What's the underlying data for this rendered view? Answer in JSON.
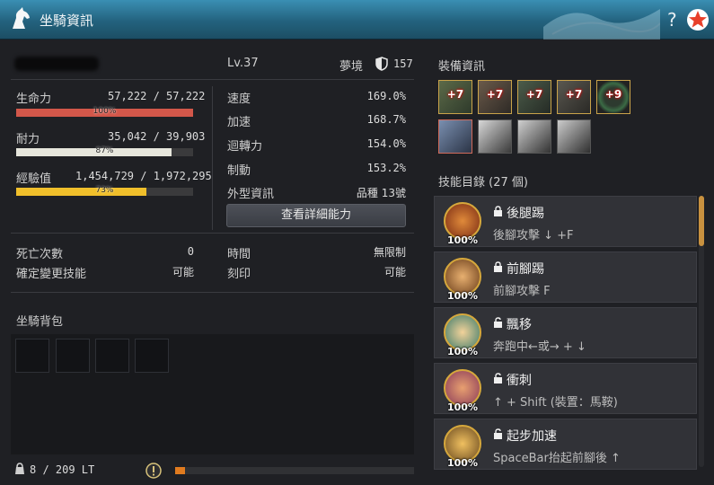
{
  "window": {
    "title": "坐騎資訊"
  },
  "profile": {
    "level": "Lv.37",
    "dream_label": "夢境",
    "dream_value": "157"
  },
  "stats": {
    "hp": {
      "label": "生命力",
      "value": "57,222 / 57,222",
      "pct_text": "100%",
      "fill": 1.0,
      "color": "#d2574a"
    },
    "stamina": {
      "label": "耐力",
      "value": "35,042 / 39,903",
      "pct_text": "87%",
      "fill": 0.878,
      "color": "#e6e6dc"
    },
    "exp": {
      "label": "經驗值",
      "value": "1,454,729 / 1,972,295",
      "pct_text": "73%",
      "fill": 0.7376,
      "color": "#f0bf2b"
    }
  },
  "abilities": [
    {
      "label": "速度",
      "value": "169.0%"
    },
    {
      "label": "加速",
      "value": "168.7%"
    },
    {
      "label": "迴轉力",
      "value": "154.0%"
    },
    {
      "label": "制動",
      "value": "153.2%"
    },
    {
      "label": "外型資訊",
      "value": "品種 13號"
    }
  ],
  "detail_button": "查看詳細能力",
  "info": {
    "deaths_label": "死亡次數",
    "deaths_value": "0",
    "change_skill_label": "確定變更技能",
    "change_skill_value": "可能",
    "time_label": "時間",
    "time_value": "無限制",
    "imprint_label": "刻印",
    "imprint_value": "可能"
  },
  "bag": {
    "title": "坐騎背包",
    "capacity": "8 / 209 LT",
    "fill": 0.04
  },
  "equipment": {
    "title": "裝備資訊",
    "items": [
      {
        "plus": "+7",
        "icon": "saddle-icon"
      },
      {
        "plus": "+7",
        "icon": "stirrup-icon"
      },
      {
        "plus": "+7",
        "icon": "armor-icon"
      },
      {
        "plus": "+7",
        "icon": "horseshoe-icon"
      },
      {
        "plus": "+9",
        "icon": "ring-icon"
      }
    ],
    "appearance": [
      {
        "icon": "horse-appearance-icon"
      },
      {
        "icon": "horse-gear-icon"
      },
      {
        "icon": "horse-gear-icon"
      },
      {
        "icon": "horse-gear-icon"
      }
    ]
  },
  "skills": {
    "title": "技能目錄 (27 個)",
    "items": [
      {
        "name": "後腿踢",
        "desc": "後腳攻擊 ↓ +F",
        "pct": "100%",
        "locked": true
      },
      {
        "name": "前腳踢",
        "desc": "前腳攻擊 F",
        "pct": "100%",
        "locked": true
      },
      {
        "name": "飄移",
        "desc": "奔跑中←或→ + ↓",
        "pct": "100%",
        "locked": false
      },
      {
        "name": "衝刺",
        "desc": "↑ + Shift (裝置：馬鞍)",
        "pct": "100%",
        "locked": false
      },
      {
        "name": "起步加速",
        "desc": "SpaceBar抬起前腳後 ↑",
        "pct": "100%",
        "locked": false
      }
    ]
  }
}
